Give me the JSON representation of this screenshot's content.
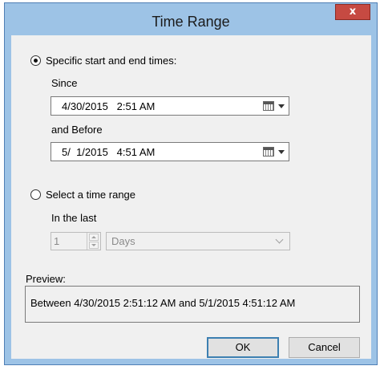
{
  "window": {
    "title": "Time Range",
    "close_glyph": "x"
  },
  "specific": {
    "radio_label": "Specific start and end times:",
    "selected": true,
    "since_label": "Since",
    "since_value": "4/30/2015   2:51 AM",
    "before_label": "and Before",
    "before_value": "5/  1/2015   4:51 AM"
  },
  "range": {
    "radio_label": "Select a time range",
    "selected": false,
    "in_the_last_label": "In the last",
    "count_value": "1",
    "unit_value": "Days"
  },
  "preview": {
    "label": "Preview:",
    "text": "Between 4/30/2015 2:51:12 AM and 5/1/2015 4:51:12 AM"
  },
  "buttons": {
    "ok": "OK",
    "cancel": "Cancel"
  },
  "icons": {
    "calendar": "calendar-icon",
    "dropdown": "chevron-down-icon",
    "close": "close-icon"
  },
  "colors": {
    "frame": "#9dc3e6",
    "close": "#c64a42",
    "client": "#f0f0f0",
    "default_button_border": "#3c7fb1"
  }
}
